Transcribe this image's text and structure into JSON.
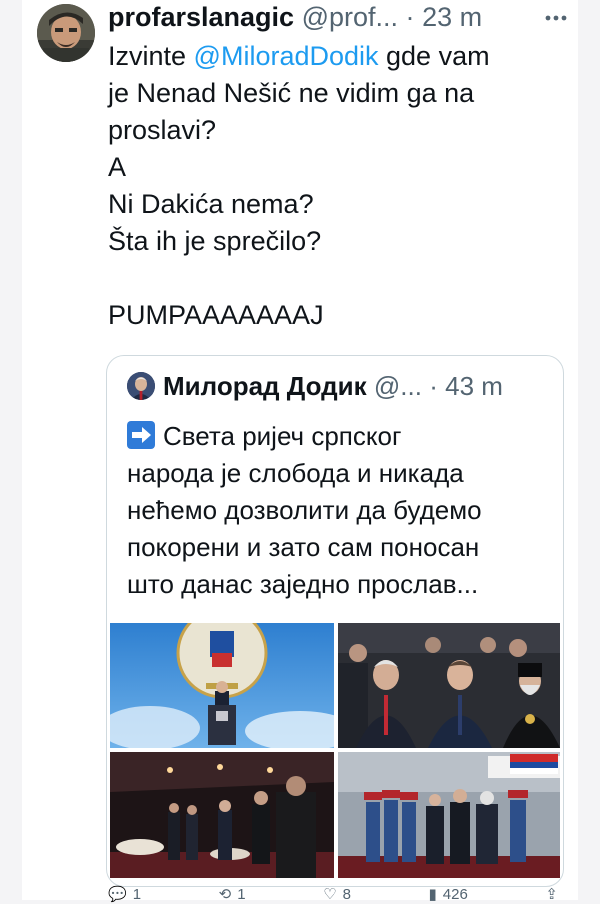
{
  "tweet": {
    "display_name": "profarslanagic",
    "handle": "@prof...",
    "separator": "·",
    "time": "23 m",
    "text_lines": [
      {
        "before": "Izvinte ",
        "mention": "@MiloradDodik",
        "after": " gde vam"
      },
      "je Nenad Nešić ne vidim ga na",
      "proslavi?",
      "A",
      "Ni Dakića nema?",
      "Šta ih je sprečilo?",
      "",
      "PUMPAAAAAAAJ"
    ],
    "more_icon": "more-horizontal-icon",
    "avatar_icon": "user-avatar"
  },
  "quote": {
    "display_name": "Милорад Додик",
    "handle": "@...",
    "separator": "·",
    "time": "43 m",
    "emoji": "right-arrow-emoji",
    "text_lines": [
      "Света ријеч српског",
      "народа је слобода и никада",
      "нећемо дозволити да будемо",
      "покорени и зато сам поносан",
      "што данас заједно прослав..."
    ],
    "photos": [
      "stage-podium-photo",
      "officials-seated-photo",
      "banquet-hall-photo",
      "honor-guard-airport-photo"
    ]
  },
  "actions": {
    "reply_icon": "reply-icon",
    "reply_count": "1",
    "retweet_icon": "retweet-icon",
    "retweet_count": "1",
    "like_icon": "heart-icon",
    "like_count": "8",
    "views_icon": "views-icon",
    "views_count": "426",
    "share_icon": "share-icon"
  },
  "colors": {
    "mention": "#1d9bf0",
    "secondary_text": "#536471",
    "border": "#cfd9de"
  }
}
